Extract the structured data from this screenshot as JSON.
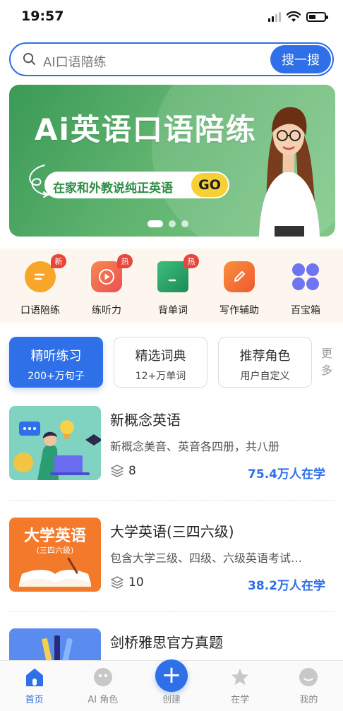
{
  "status": {
    "time": "19:57"
  },
  "search": {
    "placeholder": "AI口语陪练",
    "button_label": "搜一搜"
  },
  "banner": {
    "title": "Ai英语口语陪练",
    "subtitle": "在家和外教说纯正英语",
    "cta": "GO",
    "slides_total": 3,
    "active_slide": 1
  },
  "features": [
    {
      "label": "口语陪练",
      "badge": "新",
      "icon": "chat-bubble-icon",
      "color": "#f5a623"
    },
    {
      "label": "练听力",
      "badge": "热",
      "icon": "play-icon",
      "color": "#f0634d"
    },
    {
      "label": "背单词",
      "badge": "热",
      "icon": "book-icon",
      "color": "#28a06a"
    },
    {
      "label": "写作辅助",
      "badge": "",
      "icon": "pencil-icon",
      "color": "#f36f3a"
    },
    {
      "label": "百宝箱",
      "badge": "",
      "icon": "grid-icon",
      "color": "#6a6cf0"
    }
  ],
  "tabs": [
    {
      "title": "精听练习",
      "sub": "200+万句子",
      "active": true
    },
    {
      "title": "精选词典",
      "sub": "12+万单词",
      "active": false
    },
    {
      "title": "推荐角色",
      "sub": "用户自定义",
      "active": false
    }
  ],
  "tabs_more": "更多",
  "courses": [
    {
      "title": "新概念英语",
      "desc": "新概念美音、英音各四册，共八册",
      "lessons": "8",
      "learners": "75.4万人在学"
    },
    {
      "title": "大学英语(三四六级)",
      "desc": "包含大学三级、四级、六级英语考试…",
      "lessons": "10",
      "learners": "38.2万人在学",
      "thumb_title": "大学英语",
      "thumb_sub": "(三四六级)"
    },
    {
      "title": "剑桥雅思官方真题"
    }
  ],
  "nav": [
    {
      "label": "首页",
      "active": true
    },
    {
      "label": "AI 角色",
      "active": false
    },
    {
      "label": "创建",
      "active": false
    },
    {
      "label": "在学",
      "active": false
    },
    {
      "label": "我的",
      "active": false
    }
  ],
  "colors": {
    "accent": "#2f6fe8",
    "banner_green": "#4fa862",
    "badge_red": "#e8453c"
  }
}
